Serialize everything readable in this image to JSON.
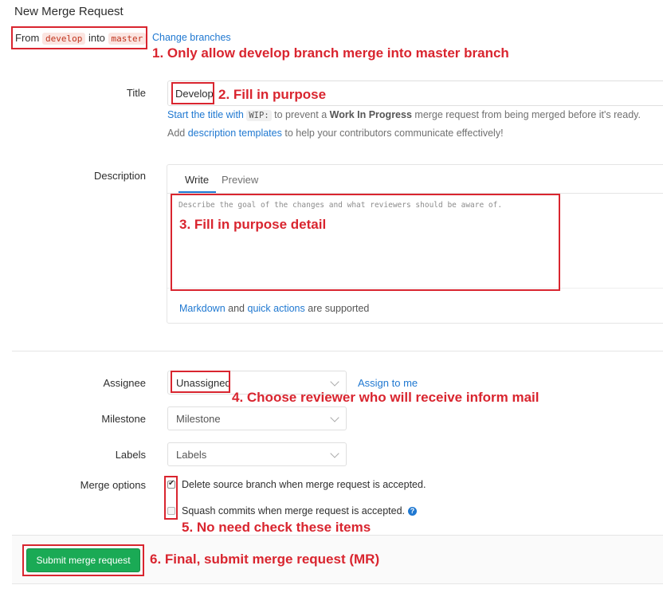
{
  "page": {
    "title": "New Merge Request"
  },
  "branches": {
    "from_label": "From",
    "source": "develop",
    "into_label": "into",
    "target": "master",
    "change_link": "Change branches"
  },
  "annotations": {
    "a1": "1. Only allow develop branch merge into master branch",
    "a2": "2. Fill in purpose",
    "a3": "3. Fill in purpose detail",
    "a4": "4. Choose reviewer who will receive inform mail",
    "a5": "5. No need check these items",
    "a6": "6. Final, submit merge request (MR)"
  },
  "title_field": {
    "label": "Title",
    "value": "Develop",
    "help1_pre": "Start the title with",
    "help1_code": "WIP:",
    "help1_mid": "to prevent a",
    "help1_bold": "Work In Progress",
    "help1_post": "merge request from being merged before it's ready.",
    "help2_pre": "Add",
    "help2_link": "description templates",
    "help2_post": "to help your contributors communicate effectively!"
  },
  "description": {
    "label": "Description",
    "tab_write": "Write",
    "tab_preview": "Preview",
    "placeholder": "Describe the goal of the changes and what reviewers should be aware of.",
    "footer_link1": "Markdown",
    "footer_and": "and",
    "footer_link2": "quick actions",
    "footer_post": "are supported"
  },
  "assignee": {
    "label": "Assignee",
    "value": "Unassigned",
    "assign_me": "Assign to me"
  },
  "milestone": {
    "label": "Milestone",
    "value": "Milestone"
  },
  "labels": {
    "label": "Labels",
    "value": "Labels"
  },
  "merge_options": {
    "label": "Merge options",
    "delete_source": "Delete source branch when merge request is accepted.",
    "delete_source_checked": true,
    "squash": "Squash commits when merge request is accepted.",
    "squash_checked": false,
    "help_icon": "?"
  },
  "footer": {
    "submit_label": "Submit merge request"
  },
  "colors": {
    "accent_red": "#d9252f",
    "link": "#1f78d1",
    "submit_green": "#1aaa55"
  }
}
